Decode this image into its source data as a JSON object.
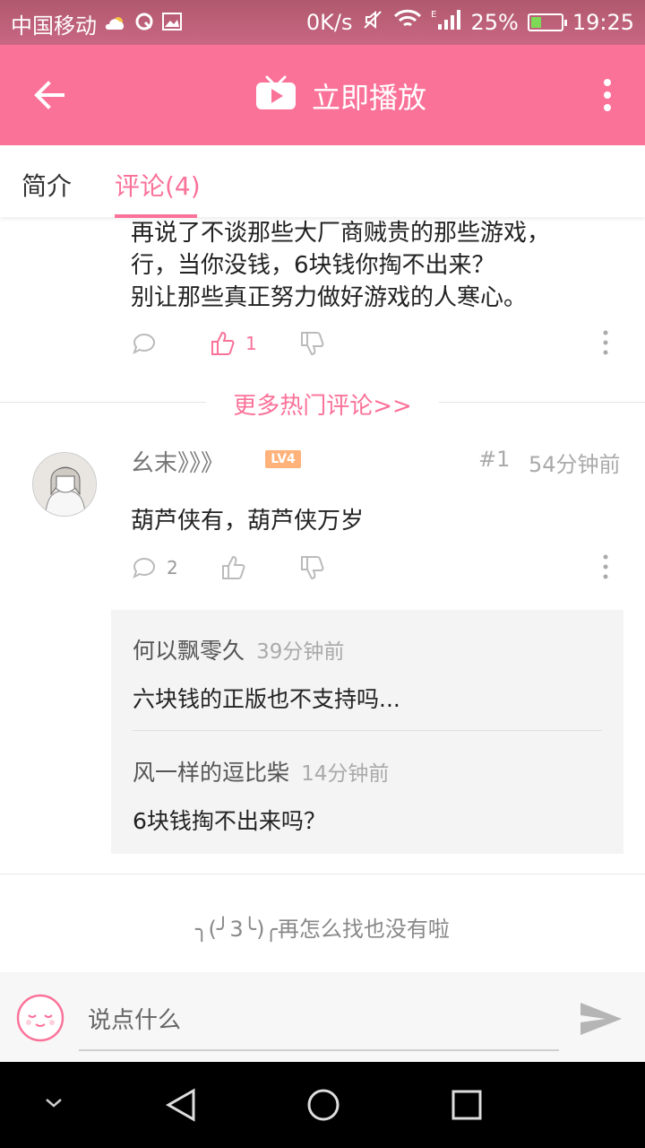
{
  "status_bar": {
    "carrier": "中国移动",
    "speed": "0K/s",
    "network": "E",
    "battery": "25%",
    "time": "19:25"
  },
  "app_bar": {
    "title": "立即播放"
  },
  "tabs": {
    "intro": "简介",
    "comments": "评论(4)"
  },
  "hot_comment": {
    "lines": [
      "再说了不谈那些大厂商贼贵的那些游戏，",
      "行，当你没钱，6块钱你掏不出来？",
      "别让那些真正努力做好游戏的人寒心。"
    ],
    "like_count": "1"
  },
  "more_hot_link": "更多热门评论>>",
  "comment": {
    "username": "幺末》》》",
    "level_badge": "LV4",
    "floor": "#1",
    "time": "54分钟前",
    "text": "葫芦侠有，葫芦侠万岁",
    "reply_count": "2",
    "replies": [
      {
        "user": "何以飘零久",
        "time": "39分钟前",
        "text": "六块钱的正版也不支持吗..."
      },
      {
        "user": "风一样的逗比柴",
        "time": "14分钟前",
        "text": "6块钱掏不出来吗？"
      }
    ]
  },
  "end_message": "╮(╯3╰)╭再怎么找也没有啦",
  "input": {
    "placeholder": "说点什么"
  },
  "colors": {
    "brand_pink": "#fb7299",
    "status_bar": "#c96784"
  }
}
